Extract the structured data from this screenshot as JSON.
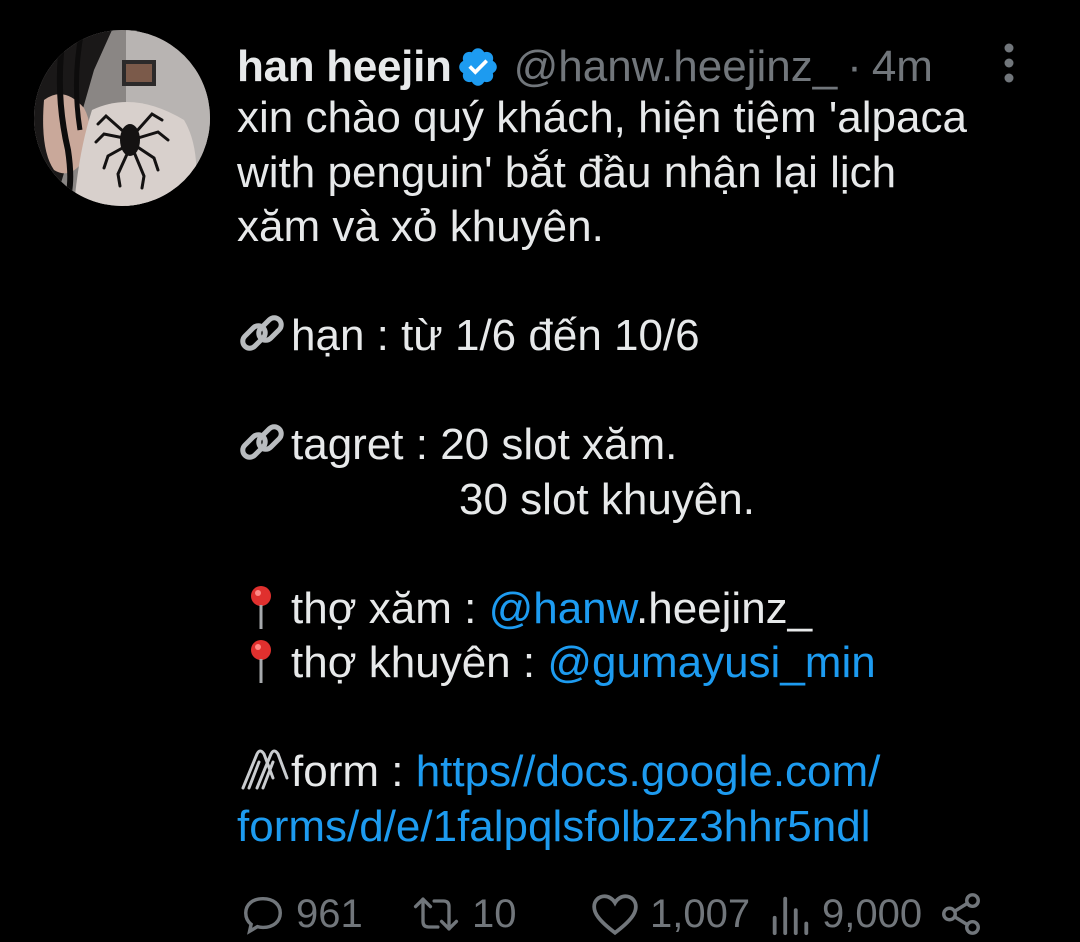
{
  "tweet": {
    "author": {
      "name": "han heejin",
      "handle": "@hanw.heejinz_",
      "verified": true,
      "avatar_icon": "profile-photo"
    },
    "separator": "·",
    "time": "4m",
    "text": {
      "line1": "xin chào quý khách, hiện tiệm 'alpaca",
      "line2": "with penguin' bắt đầu nhận lại lịch",
      "line3": "xăm và xỏ khuyên.",
      "deadline": "hạn : từ 1/6 đến 10/6",
      "target_line1": "tagret : 20 slot xăm.",
      "target_line2": "30 slot khuyên.",
      "tattoo_label": "thợ xăm : ",
      "tattoo_mention": "@hanw",
      "tattoo_mention_rest": ".heejinz_",
      "piercing_label": "thợ khuyên : ",
      "piercing_mention": "@gumayusi_min",
      "form_label": "form : ",
      "form_link_line1": "https//docs.google.com/",
      "form_link_line2": "forms/d/e/1falpqlsfolbzz3hhr5ndl"
    },
    "emoji": {
      "deadline": "link-emoji",
      "target": "link-emoji",
      "tattoo": "round-pushpin-emoji",
      "piercing": "round-pushpin-emoji",
      "form": "linked-paperclips-emoji"
    },
    "stats": {
      "replies": "961",
      "retweets": "10",
      "likes": "1,007",
      "views": "9,000"
    }
  },
  "colors": {
    "background": "#000000",
    "text": "#e7e9ea",
    "secondary": "#71767b",
    "link": "#1d9bf0",
    "verified": "#1d9bf0"
  }
}
